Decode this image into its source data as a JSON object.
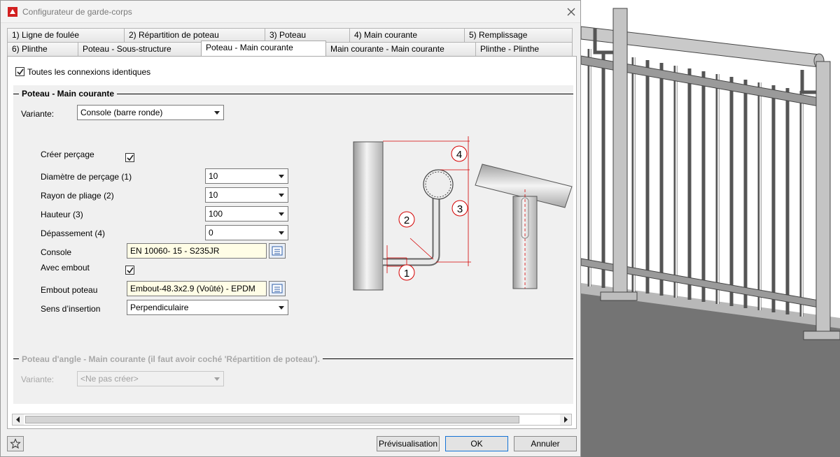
{
  "window": {
    "title": "Configurateur de garde-corps",
    "close_icon": "close-icon",
    "app_icon": "app-logo-icon"
  },
  "tabs_row1": [
    {
      "label": "1) Ligne de foulée"
    },
    {
      "label": "2) Répartition de poteau"
    },
    {
      "label": "3) Poteau"
    },
    {
      "label": "4) Main courante"
    },
    {
      "label": "5) Remplissage"
    }
  ],
  "tabs_row2": [
    {
      "label": "6) Plinthe"
    },
    {
      "label": "Poteau - Sous-structure"
    },
    {
      "label": "Poteau - Main courante",
      "active": true
    },
    {
      "label": "Main courante - Main courante"
    },
    {
      "label": "Plinthe - Plinthe"
    }
  ],
  "all_identical": {
    "label": "Toutes les connexions identiques",
    "checked": true
  },
  "section_main": {
    "title": "Poteau - Main courante",
    "variant_label": "Variante:",
    "variant_value": "Console (barre ronde)"
  },
  "form": {
    "create_drilling": {
      "label": "Créer perçage",
      "checked": true
    },
    "drill_diameter": {
      "label": "Diamètre de perçage (1)",
      "value": "10"
    },
    "bend_radius": {
      "label": "Rayon de pliage (2)",
      "value": "10"
    },
    "height": {
      "label": "Hauteur (3)",
      "value": "100"
    },
    "overhang": {
      "label": "Dépassement (4)",
      "value": "0"
    },
    "console": {
      "label": "Console",
      "value": "EN 10060- 15 - S235JR"
    },
    "with_endcap": {
      "label": "Avec embout",
      "checked": true
    },
    "post_endcap": {
      "label": "Embout poteau",
      "value": "Embout-48.3x2.9 (Voûté) - EPDM"
    },
    "insert_direction": {
      "label": "Sens d’insertion",
      "value": "Perpendiculaire"
    }
  },
  "diagram": {
    "markers": [
      "1",
      "2",
      "3",
      "4"
    ]
  },
  "section_angle": {
    "title": "Poteau d'angle - Main courante (il faut avoir coché 'Répartition de poteau').",
    "variant_label": "Variante:",
    "variant_value": "<Ne pas créer>"
  },
  "footer": {
    "favorite_icon": "star-icon",
    "preview_label": "Prévisualisation",
    "ok_label": "OK",
    "cancel_label": "Annuler"
  },
  "colors": {
    "accent": "#1473d6",
    "dimension_red": "#d40000",
    "field_yellow": "#fffde6"
  }
}
